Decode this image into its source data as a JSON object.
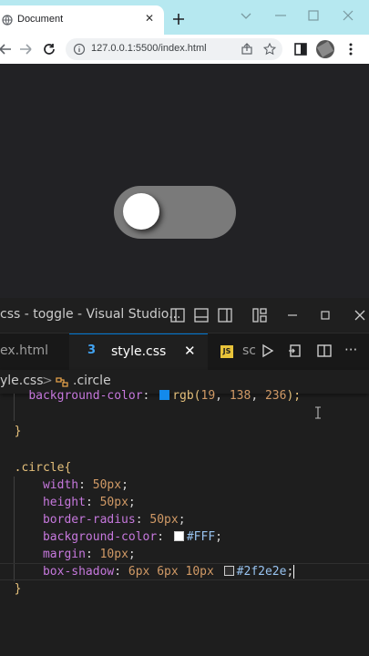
{
  "browser": {
    "tab_title": "Document",
    "tab_close": "✕",
    "url": "127.0.0.1:5500/index.html",
    "toggle_state": "off",
    "accent_tabstrip": "#b6e8f0"
  },
  "vscode": {
    "title": "css - toggle - Visual Studio...",
    "tabs": [
      {
        "label": "ex.html"
      },
      {
        "label": "style.css",
        "active": true
      },
      {
        "label": "sc"
      }
    ],
    "tab_close": "✕",
    "file_icon_css": "3",
    "file_icon_js": "JS",
    "more": "···",
    "breadcrumb": {
      "file": "yle.css",
      "separator": ">",
      "symbol": ".circle"
    },
    "code": {
      "line1": {
        "prop": "background-color",
        "colon": ": ",
        "rgb": "rgb(",
        "n1": "19",
        "n2": "138",
        "n3": "236",
        "tail": ");",
        "swatch": "#138aec"
      },
      "line2": {
        "brace": "}"
      },
      "line4": {
        "sel": ".circle",
        "brace": "{"
      },
      "line5": {
        "prop": "width",
        "colon": ": ",
        "val": "50px",
        "semi": ";"
      },
      "line6": {
        "prop": "height",
        "colon": ": ",
        "val": "50px",
        "semi": ";"
      },
      "line7": {
        "prop": "border-radius",
        "colon": ": ",
        "val": "50px",
        "semi": ";"
      },
      "line8": {
        "prop": "background-color",
        "colon": ": ",
        "val": "#FFF",
        "semi": ";",
        "swatch": "#ffffff"
      },
      "line9": {
        "prop": "margin",
        "colon": ": ",
        "val": "10px",
        "semi": ";"
      },
      "line10": {
        "prop": "box-shadow",
        "colon": ": ",
        "v1": "6px",
        "v2": "6px",
        "v3": "10px",
        "hex": "#2f2e2e",
        "semi": ";",
        "swatch": "#2f2e2e"
      },
      "line11": {
        "brace": "}"
      }
    }
  }
}
